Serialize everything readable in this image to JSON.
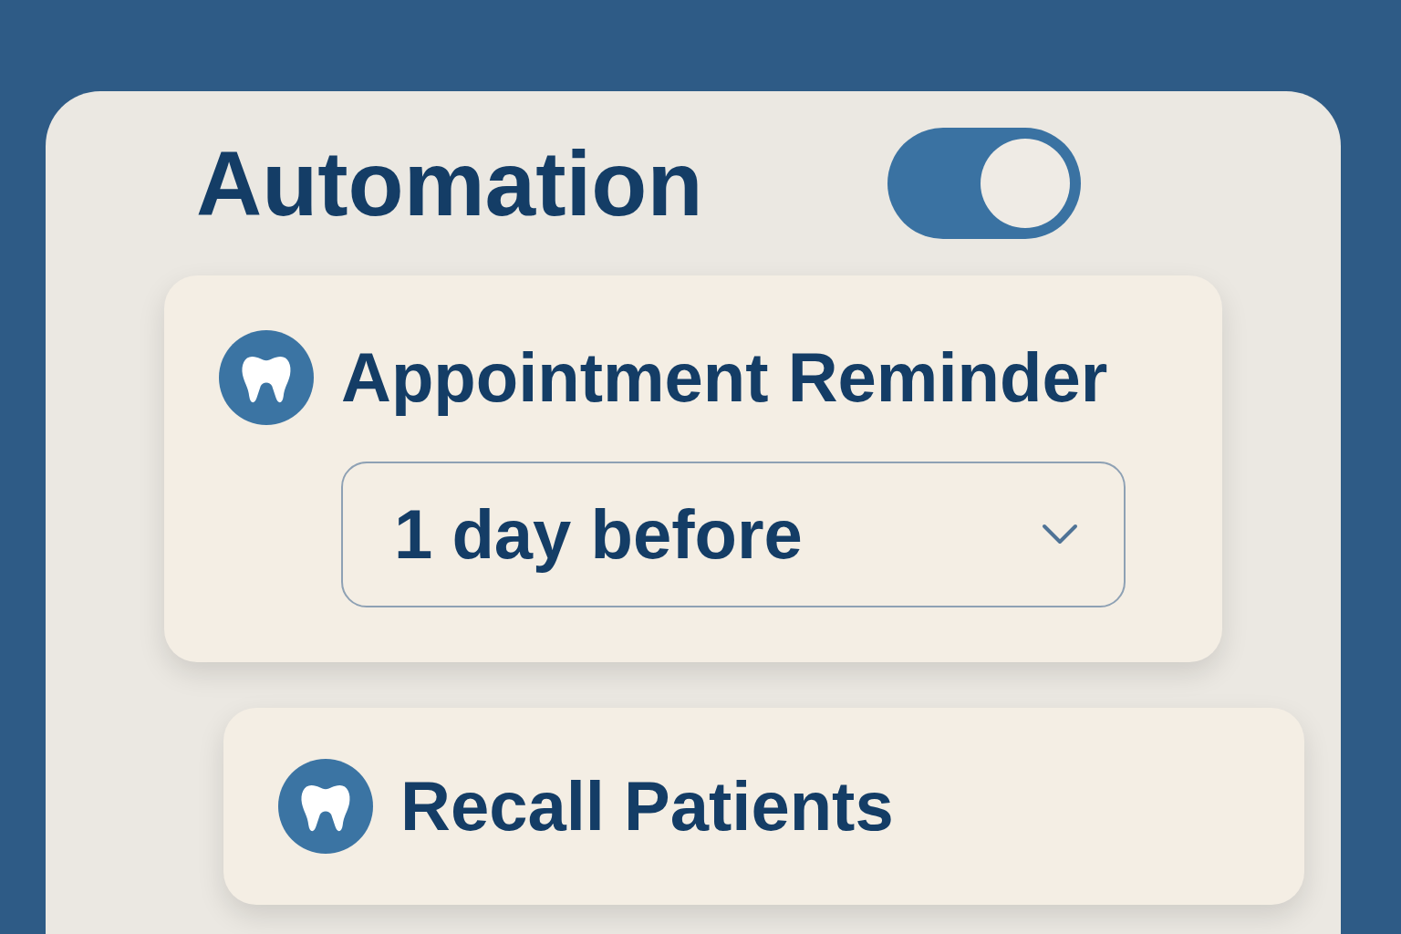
{
  "panel": {
    "title": "Automation",
    "toggle": {
      "on": true
    }
  },
  "automations": [
    {
      "kind": "dropdown",
      "title": "Appointment Reminder",
      "select": {
        "value": "1 day before"
      }
    },
    {
      "kind": "plain",
      "title": "Recall Patients"
    }
  ]
}
